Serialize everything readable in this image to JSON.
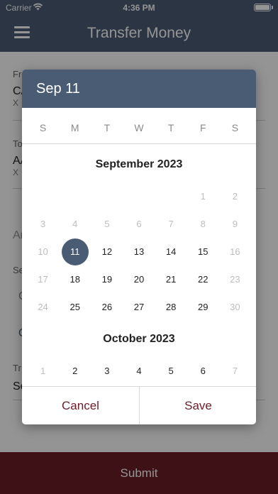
{
  "status": {
    "carrier": "Carrier",
    "time": "4:36 PM"
  },
  "header": {
    "title": "Transfer Money",
    "menu_icon": "hamburger-menu-icon"
  },
  "form": {
    "from_label": "From",
    "from_value": "CA",
    "from_sub": "X",
    "to_label": "To",
    "to_value": "AA",
    "to_sub": "X",
    "amount_label": "Am",
    "section_label": "Se",
    "option_a": "C",
    "option_b": "O",
    "transfer_date_label": "Tr",
    "transfer_date_value": "Se"
  },
  "submit_label": "Submit",
  "picker": {
    "header_date": "Sep 11",
    "weekdays": [
      "S",
      "M",
      "T",
      "W",
      "T",
      "F",
      "S"
    ],
    "months": [
      {
        "title": "September 2023",
        "weeks": [
          [
            "",
            "",
            "",
            "",
            "",
            "1",
            "2"
          ],
          [
            "3",
            "4",
            "5",
            "6",
            "7",
            "8",
            "9"
          ],
          [
            "10",
            "11",
            "12",
            "13",
            "14",
            "15",
            "16"
          ],
          [
            "17",
            "18",
            "19",
            "20",
            "21",
            "22",
            "23"
          ],
          [
            "24",
            "25",
            "26",
            "27",
            "28",
            "29",
            "30"
          ]
        ]
      },
      {
        "title": "October 2023",
        "weeks": [
          [
            "1",
            "2",
            "3",
            "4",
            "5",
            "6",
            "7"
          ]
        ]
      }
    ],
    "selected": "11",
    "cancel_label": "Cancel",
    "save_label": "Save"
  },
  "colors": {
    "header": "#4a5c74",
    "accent": "#6b1e28",
    "selected": "#4a5c74"
  }
}
